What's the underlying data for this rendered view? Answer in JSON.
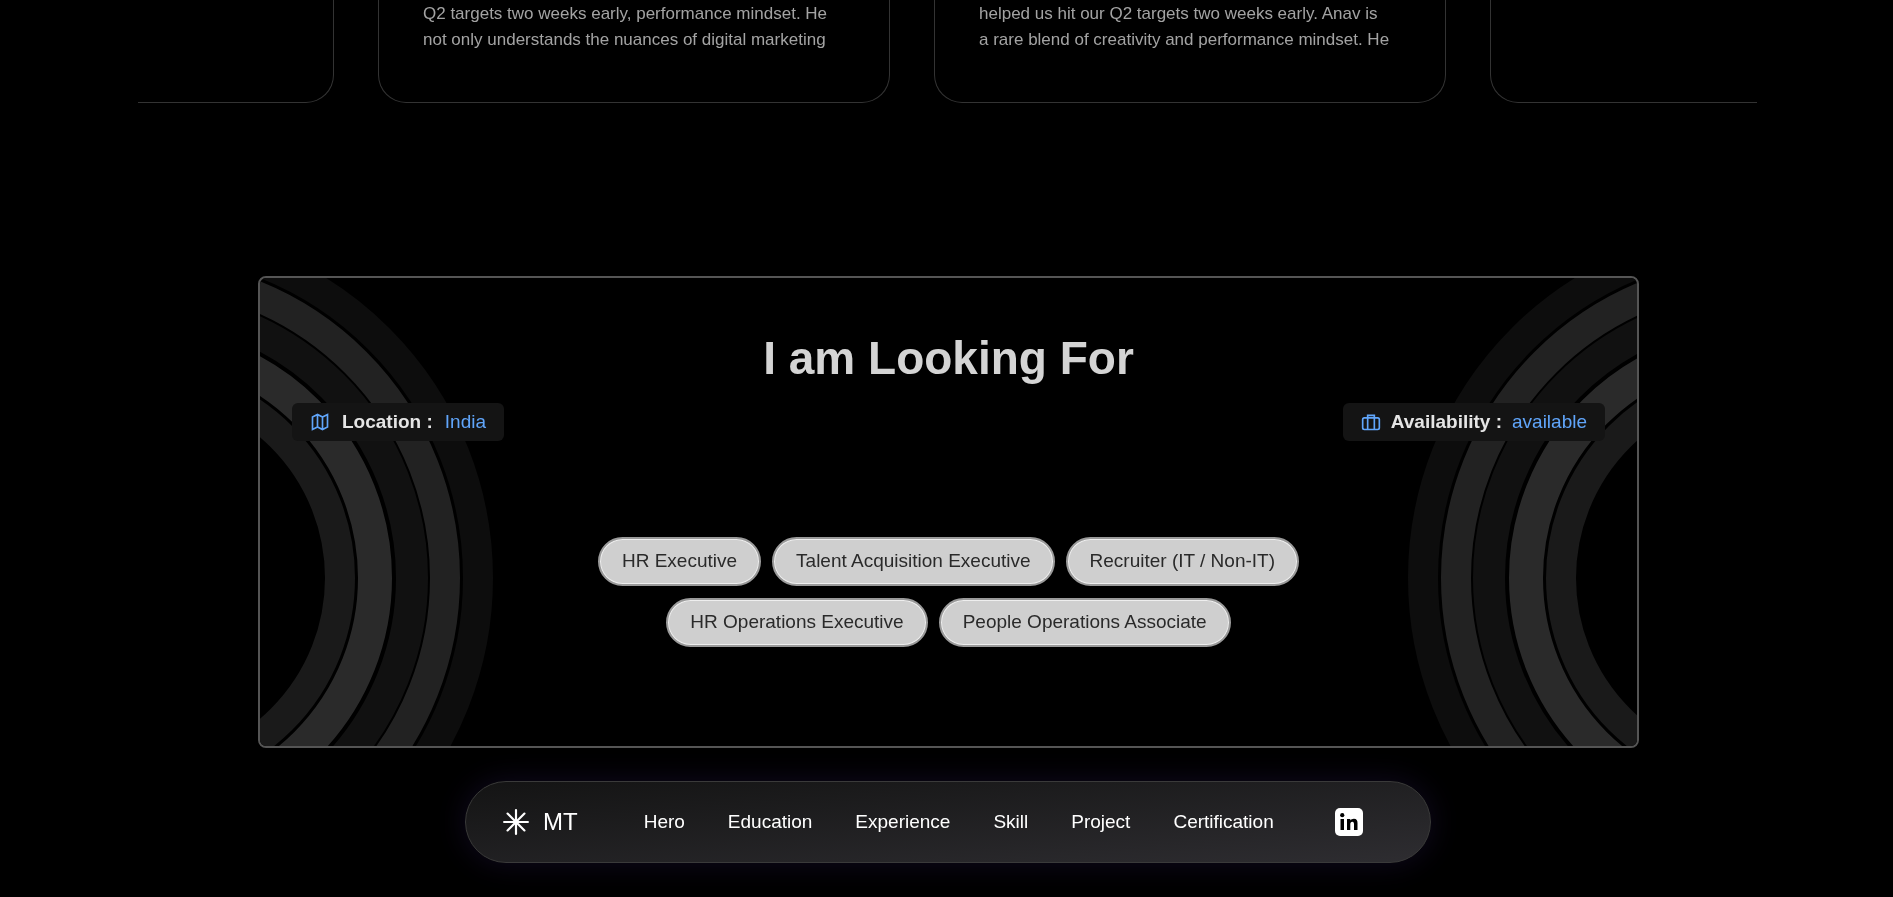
{
  "testimonials": [
    {
      "lines": [
        "Q2 targets two weeks early, performance mindset. He",
        "not only understands the nuances of digital marketing"
      ]
    },
    {
      "lines": [
        "helped us hit our Q2 targets two weeks early. Anav is",
        "a rare blend of creativity and performance mindset. He"
      ]
    }
  ],
  "looking_for": {
    "title": "I am Looking For",
    "location": {
      "label": "Location :",
      "value": "India"
    },
    "availability": {
      "label": "Availability :",
      "value": "available"
    },
    "roles": [
      [
        "HR Executive",
        "Talent Acquisition Executive",
        "Recruiter (IT / Non-IT)"
      ],
      [
        "HR Operations Executive",
        "People Operations Associate"
      ]
    ]
  },
  "nav": {
    "logo": "MT",
    "items": [
      "Hero",
      "Education",
      "Experience",
      "Skill",
      "Project",
      "Certification"
    ]
  }
}
